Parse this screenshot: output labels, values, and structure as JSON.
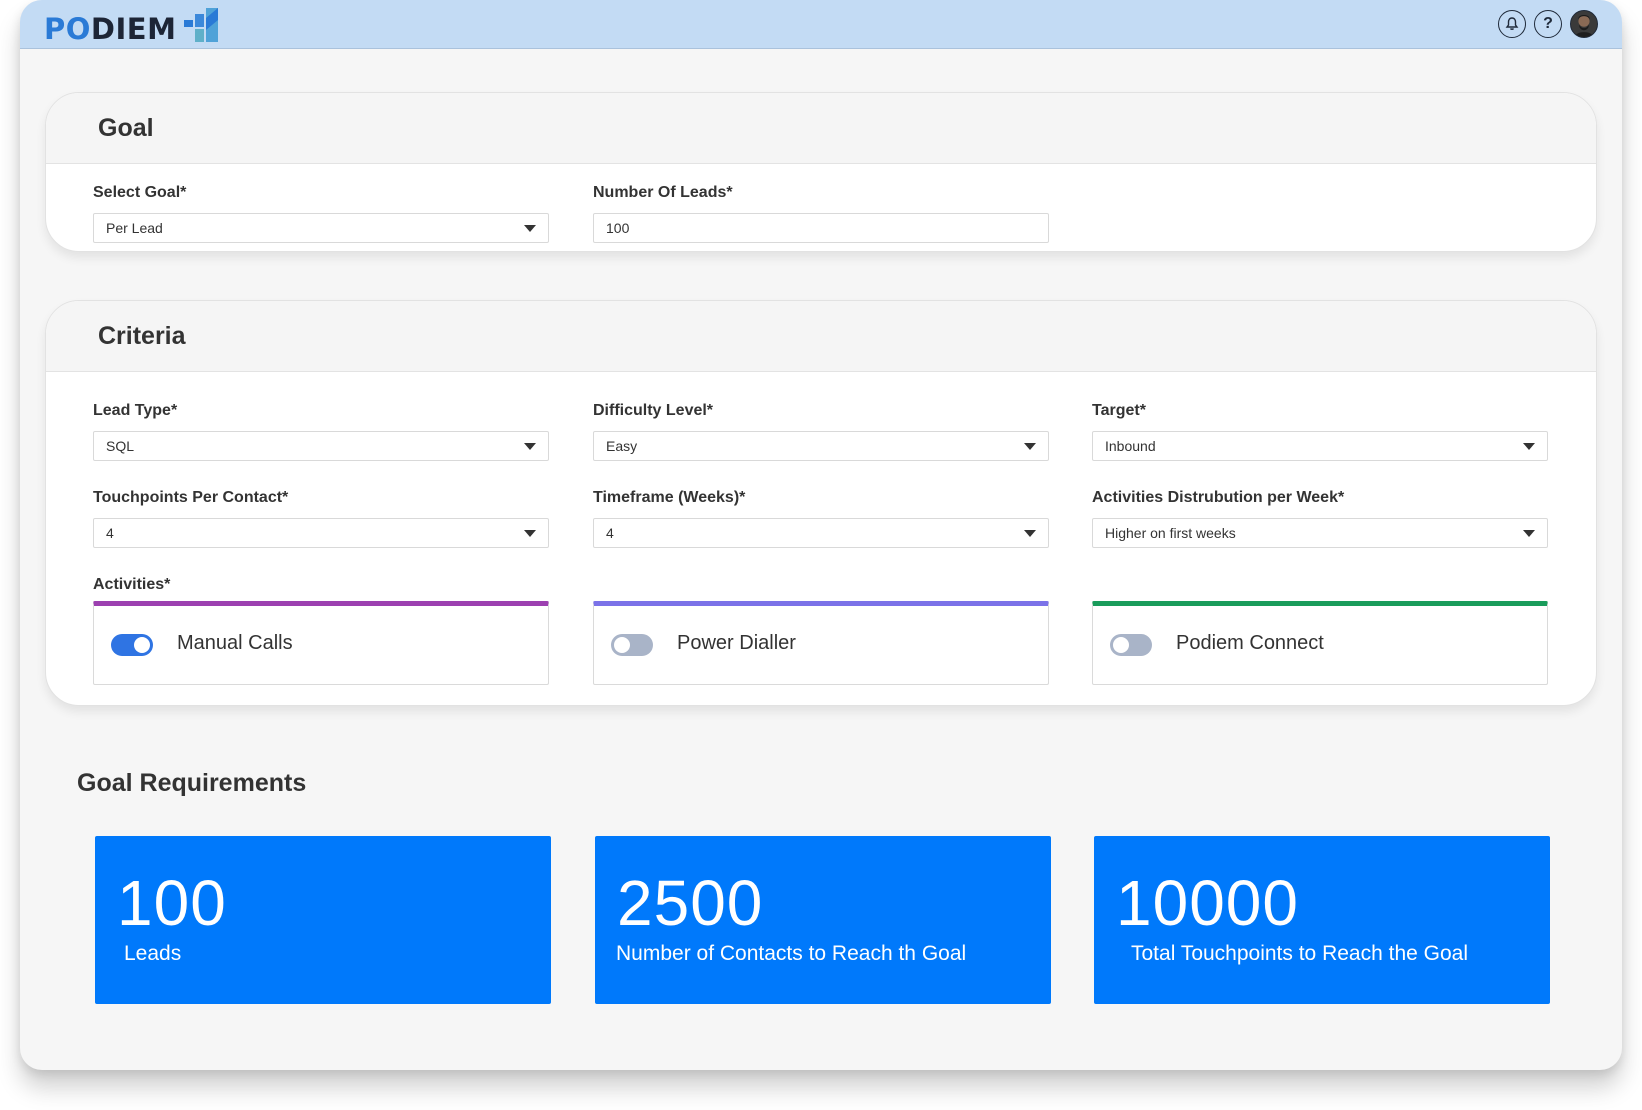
{
  "app": {
    "logo_part1": "PO",
    "logo_part2": "DIEM"
  },
  "header_icons": {
    "notifications": "bell-icon",
    "help": "help-icon",
    "help_glyph": "?",
    "avatar": "avatar-icon"
  },
  "goal": {
    "title": "Goal",
    "select_goal": {
      "label": "Select Goal*",
      "value": "Per Lead"
    },
    "number_of_leads": {
      "label": "Number Of Leads*",
      "value": "100"
    }
  },
  "criteria": {
    "title": "Criteria",
    "lead_type": {
      "label": "Lead Type*",
      "value": "SQL"
    },
    "difficulty_level": {
      "label": "Difficulty Level*",
      "value": "Easy"
    },
    "target": {
      "label": "Target*",
      "value": "Inbound"
    },
    "touchpoints": {
      "label": "Touchpoints Per Contact*",
      "value": "4"
    },
    "timeframe": {
      "label": "Timeframe (Weeks)*",
      "value": "4"
    },
    "distribution": {
      "label": "Activities Distrubution per Week*",
      "value": "Higher on first weeks"
    },
    "activities_label": "Activities*",
    "activities": [
      {
        "label": "Manual Calls",
        "enabled": true,
        "accent": "#9c40b0"
      },
      {
        "label": "Power Dialler",
        "enabled": false,
        "accent": "#7b72e8"
      },
      {
        "label": "Podiem Connect",
        "enabled": false,
        "accent": "#1a9c5b"
      }
    ]
  },
  "requirements": {
    "title": "Goal Requirements",
    "cards": [
      {
        "value": "100",
        "label": "Leads"
      },
      {
        "value": "2500",
        "label": "Number of Contacts to Reach th Goal"
      },
      {
        "value": "10000",
        "label": "Total Touchpoints to Reach the Goal"
      }
    ]
  },
  "colors": {
    "topbar": "#c3dbf4",
    "stat_card": "#0079fb",
    "toggle_on": "#2f74e3",
    "toggle_off": "#a9b4c8"
  }
}
